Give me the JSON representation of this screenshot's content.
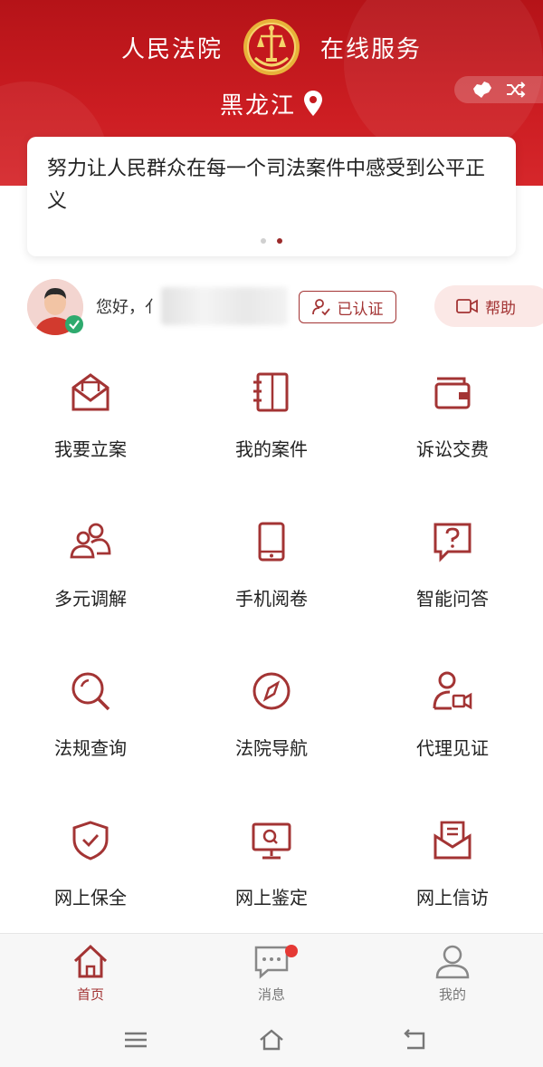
{
  "header": {
    "title_left": "人民法院",
    "title_right": "在线服务",
    "region": "黑龙江",
    "region_switch_icons": [
      "china-map-icon",
      "shuffle-icon"
    ]
  },
  "banner": {
    "text": "努力让人民群众在每一个司法案件中感受到公平正义",
    "dots": 2,
    "active_dot": 2
  },
  "user": {
    "greeting": "您好，亻",
    "verified_label": "已认证",
    "help_label": "帮助"
  },
  "services": [
    {
      "label": "我要立案",
      "icon": "envelope-file-icon"
    },
    {
      "label": "我的案件",
      "icon": "notebook-icon"
    },
    {
      "label": "诉讼交费",
      "icon": "wallet-icon"
    },
    {
      "label": "多元调解",
      "icon": "people-icon"
    },
    {
      "label": "手机阅卷",
      "icon": "phone-icon"
    },
    {
      "label": "智能问答",
      "icon": "question-bubble-icon"
    },
    {
      "label": "法规查询",
      "icon": "search-icon"
    },
    {
      "label": "法院导航",
      "icon": "compass-icon"
    },
    {
      "label": "代理见证",
      "icon": "video-person-icon"
    },
    {
      "label": "网上保全",
      "icon": "shield-check-icon"
    },
    {
      "label": "网上鉴定",
      "icon": "monitor-search-icon"
    },
    {
      "label": "网上信访",
      "icon": "mail-letter-icon"
    }
  ],
  "tabs": [
    {
      "label": "首页",
      "icon": "home-icon",
      "active": true
    },
    {
      "label": "消息",
      "icon": "message-icon",
      "badge": true
    },
    {
      "label": "我的",
      "icon": "user-icon"
    }
  ],
  "colors": {
    "header_red": "#c4181d",
    "accent": "#a33434",
    "badge_green": "#2eaa6e",
    "notify_red": "#e53935"
  }
}
